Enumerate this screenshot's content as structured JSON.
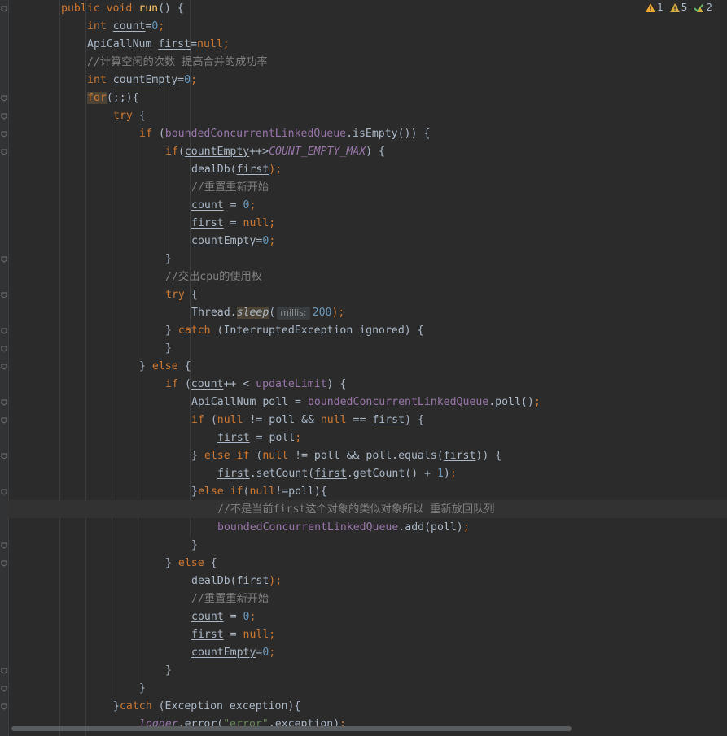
{
  "inspections": {
    "errors": "1",
    "warnings": "5",
    "weak_warnings": "2"
  },
  "editor": {
    "l1_kw": "public void ",
    "l1_fn": "run",
    "l1_rest": "() {",
    "l2_kw": "int ",
    "l2_var": "count",
    "l2_eq": "=",
    "l2_num": "0",
    "l2_semi": ";",
    "l3_type": "ApiCallNum ",
    "l3_var": "first",
    "l3_eq": "=",
    "l3_null": "null",
    "l3_semi": ";",
    "l4_cmt": "//计算空闲的次数 提高合并的成功率",
    "l5_kw": "int ",
    "l5_var": "countEmpty",
    "l5_eq": "=",
    "l5_num": "0",
    "l5_semi": ";",
    "l6_kw": "for",
    "l6_rest": "(;;){",
    "l7_kw": "try",
    "l7_rest": " {",
    "l8_kw": "if",
    "l8_p": " (",
    "l8_fld": "boundedConcurrentLinkedQueue",
    "l8_rest": ".isEmpty()) {",
    "l9_kw": "if",
    "l9_p": "(",
    "l9_var": "countEmpty",
    "l9_op": "++>",
    "l9_const": "COUNT_EMPTY_MAX",
    "l9_rest": ") {",
    "l10_fn": "dealDb(",
    "l10_var": "first",
    "l10_rest": ");",
    "l11_cmt": "//重置重新开始",
    "l12_var": "count",
    "l12_eq": " = ",
    "l12_num": "0",
    "l12_semi": ";",
    "l13_var": "first",
    "l13_eq": " = ",
    "l13_null": "null",
    "l13_semi": ";",
    "l14_var": "countEmpty",
    "l14_eq": "=",
    "l14_num": "0",
    "l14_semi": ";",
    "l15": "}",
    "l16_cmt": "//交出cpu的使用权",
    "l17_kw": "try",
    "l17_rest": " {",
    "l18_cls": "Thread.",
    "l18_fn": "sleep",
    "l18_p": "(",
    "l18_hint": "millis:",
    "l18_num": "200",
    "l18_rest": ");",
    "l19_b": "} ",
    "l19_kw": "catch",
    "l19_rest": " (InterruptedException ignored) {",
    "l20": "}",
    "l21_b": "} ",
    "l21_kw": "else",
    "l21_rest": " {",
    "l22_kw": "if",
    "l22_p": " (",
    "l22_var": "count",
    "l22_op": "++ < ",
    "l22_fld": "updateLimit",
    "l22_rest": ") {",
    "l23_t": "ApiCallNum poll = ",
    "l23_fld": "boundedConcurrentLinkedQueue",
    "l23_rest": ".poll()",
    "l23_semi": ";",
    "l24_kw": "if",
    "l24_p": " (",
    "l24_null1": "null",
    "l24_mid": " != poll && ",
    "l24_null2": "null",
    "l24_eq": " == ",
    "l24_var": "first",
    "l24_rest": ") {",
    "l25_var": "first",
    "l25_rest": " = poll",
    "l25_semi": ";",
    "l26_b": "} ",
    "l26_kw": "else if",
    "l26_p": " (",
    "l26_null": "null",
    "l26_mid": " != poll && poll.equals(",
    "l26_var": "first",
    "l26_rest": ")) {",
    "l27_var1": "first",
    "l27_mid": ".setCount(",
    "l27_var2": "first",
    "l27_mid2": ".getCount() + ",
    "l27_num": "1",
    "l27_rest": ")",
    "l27_semi": ";",
    "l28_b": "}",
    "l28_kw": "else if",
    "l28_p": "(",
    "l28_null": "null",
    "l28_rest": "!=poll){",
    "l29_cmt": "//不是当前first这个对象的类似对象所以 重新放回队列",
    "l30_fld": "boundedConcurrentLinkedQueue",
    "l30_rest": ".add(poll)",
    "l30_semi": ";",
    "l31": "}",
    "l32_b": "} ",
    "l32_kw": "else",
    "l32_rest": " {",
    "l33_fn": "dealDb(",
    "l33_var": "first",
    "l33_rest": ");",
    "l34_cmt": "//重置重新开始",
    "l35_var": "count",
    "l35_eq": " = ",
    "l35_num": "0",
    "l35_semi": ";",
    "l36_var": "first",
    "l36_eq": " = ",
    "l36_null": "null",
    "l36_semi": ";",
    "l37_var": "countEmpty",
    "l37_eq": "=",
    "l37_num": "0",
    "l37_semi": ";",
    "l38": "}",
    "l39": "}",
    "l40_b": "}",
    "l40_kw": "catch",
    "l40_rest": " (Exception exception){",
    "l41_fld": "logger",
    "l41_mid": ".error(",
    "l41_str": "\"error\"",
    "l41_rest": ",exception)",
    "l41_semi": ";"
  },
  "colors": {
    "background": "#2b2b2b",
    "keyword": "#cc7832",
    "number": "#6897bb",
    "string": "#6a8759",
    "comment": "#808080",
    "method": "#ffc66d",
    "field": "#9876aa",
    "text": "#a9b7c6"
  },
  "icons": {
    "error": "error-triangle-icon",
    "warning": "warning-triangle-icon",
    "weak_warning": "check-warning-icon",
    "fold": "fold-marker-icon"
  }
}
